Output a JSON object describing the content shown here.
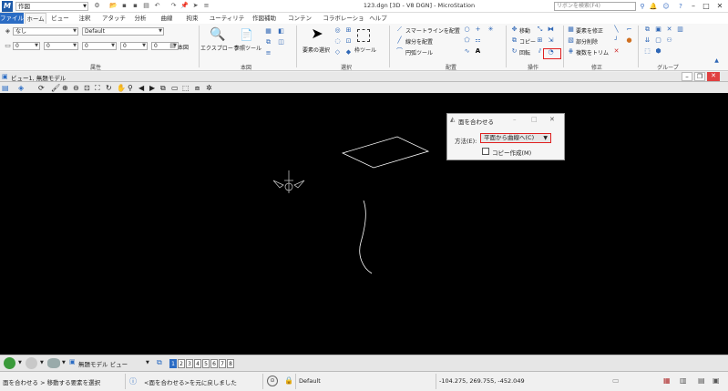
{
  "window": {
    "workspace": "作図",
    "title": "123.dgn [3D - V8 DGN] - MicroStation",
    "search_placeholder": "リボンを検索(F4)"
  },
  "tabs": [
    "ファイル",
    "ホーム",
    "ビュー",
    "注釈",
    "アタッチ",
    "分析",
    "曲線",
    "拘束",
    "ユーティリティ",
    "作図補助",
    "コンテンツ",
    "コラボレーション",
    "ヘルプ"
  ],
  "ribbon": {
    "groups": {
      "attributes": "属性",
      "primary": "本図",
      "selection": "選択",
      "placement": "配置",
      "operation": "操作",
      "modify": "修正",
      "group": "グループ"
    },
    "attr": {
      "level": "なし",
      "level_default": "Default",
      "color_value": "0",
      "weight_value": "0",
      "style_value": "0",
      "model_label": "本図"
    },
    "primary": {
      "explorer": "エクスプローラ",
      "reference_tool": "参照ツール"
    },
    "selection": {
      "select_element": "要素の選択",
      "fence_tool": "枠ツール"
    },
    "placement": {
      "smartline": "スマートラインを配置",
      "line": "線分を配置",
      "arc_tool": "円弧ツール"
    },
    "operation": {
      "move": "移動",
      "copy": "コピー",
      "rotate": "回転"
    },
    "modify": {
      "modify_element": "要素を修正",
      "partial_delete": "部分削除",
      "trim_multiple": "複数をトリム"
    }
  },
  "view": {
    "title": "ビュー1, 無題モデル"
  },
  "dialog": {
    "title": "面を合わせる",
    "method_label": "方法(E):",
    "method_value": "平面から曲線へ(C)",
    "copy_label": "コピー作成(M)",
    "copy_checked": false
  },
  "bottom_toolbar": {
    "model_view": "無題モデル ビュー",
    "view_numbers": [
      "1",
      "2",
      "3",
      "4",
      "5",
      "6",
      "7",
      "8"
    ],
    "active_view": "1"
  },
  "status": {
    "prompt": "面を合わせる > 移動する要素を選択",
    "message": "<面を合わせる>を元に戻しました",
    "level": "Default",
    "coordinates": "-104.275, 269.755, -452.049"
  },
  "colors": {
    "accent": "#2b6cc4",
    "highlight": "#e02020",
    "viewport_bg": "#000000"
  }
}
